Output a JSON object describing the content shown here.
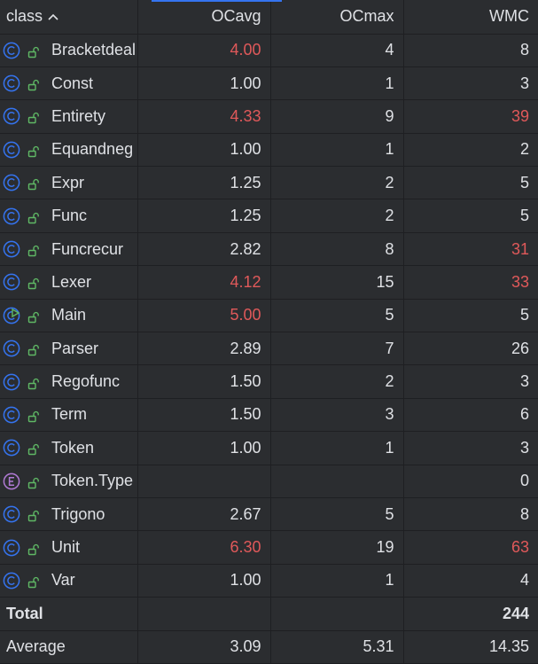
{
  "colors": {
    "background": "#2b2d30",
    "text": "#dfe1e5",
    "hot_value": "#e0595a",
    "class_icon": "#3574f0",
    "enum_icon": "#b07ad4",
    "main_run_badge": "#5fb865",
    "lock_icon": "#5fb865",
    "accent_bar": "#3574f0"
  },
  "header": {
    "class_label": "class",
    "sort_icon": "chevron-up-icon",
    "ocavg_label": "OCavg",
    "ocmax_label": "OCmax",
    "wmc_label": "WMC"
  },
  "rows": [
    {
      "name": "Bracketdeal",
      "kind": "class-icon",
      "ocavg": "4.00",
      "ocavg_hot": true,
      "ocmax": "4",
      "wmc": "8",
      "wmc_hot": false
    },
    {
      "name": "Const",
      "kind": "class-icon",
      "ocavg": "1.00",
      "ocavg_hot": false,
      "ocmax": "1",
      "wmc": "3",
      "wmc_hot": false
    },
    {
      "name": "Entirety",
      "kind": "class-icon",
      "ocavg": "4.33",
      "ocavg_hot": true,
      "ocmax": "9",
      "wmc": "39",
      "wmc_hot": true
    },
    {
      "name": "Equandneg",
      "kind": "class-icon",
      "ocavg": "1.00",
      "ocavg_hot": false,
      "ocmax": "1",
      "wmc": "2",
      "wmc_hot": false
    },
    {
      "name": "Expr",
      "kind": "class-icon",
      "ocavg": "1.25",
      "ocavg_hot": false,
      "ocmax": "2",
      "wmc": "5",
      "wmc_hot": false
    },
    {
      "name": "Func",
      "kind": "class-icon",
      "ocavg": "1.25",
      "ocavg_hot": false,
      "ocmax": "2",
      "wmc": "5",
      "wmc_hot": false
    },
    {
      "name": "Funcrecur",
      "kind": "class-icon",
      "ocavg": "2.82",
      "ocavg_hot": false,
      "ocmax": "8",
      "wmc": "31",
      "wmc_hot": true
    },
    {
      "name": "Lexer",
      "kind": "class-icon",
      "ocavg": "4.12",
      "ocavg_hot": true,
      "ocmax": "15",
      "wmc": "33",
      "wmc_hot": true
    },
    {
      "name": "Main",
      "kind": "main-class-icon",
      "ocavg": "5.00",
      "ocavg_hot": true,
      "ocmax": "5",
      "wmc": "5",
      "wmc_hot": false
    },
    {
      "name": "Parser",
      "kind": "class-icon",
      "ocavg": "2.89",
      "ocavg_hot": false,
      "ocmax": "7",
      "wmc": "26",
      "wmc_hot": false
    },
    {
      "name": "Regofunc",
      "kind": "class-icon",
      "ocavg": "1.50",
      "ocavg_hot": false,
      "ocmax": "2",
      "wmc": "3",
      "wmc_hot": false
    },
    {
      "name": "Term",
      "kind": "class-icon",
      "ocavg": "1.50",
      "ocavg_hot": false,
      "ocmax": "3",
      "wmc": "6",
      "wmc_hot": false
    },
    {
      "name": "Token",
      "kind": "class-icon",
      "ocavg": "1.00",
      "ocavg_hot": false,
      "ocmax": "1",
      "wmc": "3",
      "wmc_hot": false
    },
    {
      "name": "Token.Type",
      "kind": "enum-icon",
      "ocavg": "",
      "ocavg_hot": false,
      "ocmax": "",
      "wmc": "0",
      "wmc_hot": false
    },
    {
      "name": "Trigono",
      "kind": "class-icon",
      "ocavg": "2.67",
      "ocavg_hot": false,
      "ocmax": "5",
      "wmc": "8",
      "wmc_hot": false
    },
    {
      "name": "Unit",
      "kind": "class-icon",
      "ocavg": "6.30",
      "ocavg_hot": true,
      "ocmax": "19",
      "wmc": "63",
      "wmc_hot": true
    },
    {
      "name": "Var",
      "kind": "class-icon",
      "ocavg": "1.00",
      "ocavg_hot": false,
      "ocmax": "1",
      "wmc": "4",
      "wmc_hot": false
    }
  ],
  "total": {
    "label": "Total",
    "ocavg": "",
    "ocmax": "",
    "wmc": "244"
  },
  "average": {
    "label": "Average",
    "ocavg": "3.09",
    "ocmax": "5.31",
    "wmc": "14.35"
  }
}
